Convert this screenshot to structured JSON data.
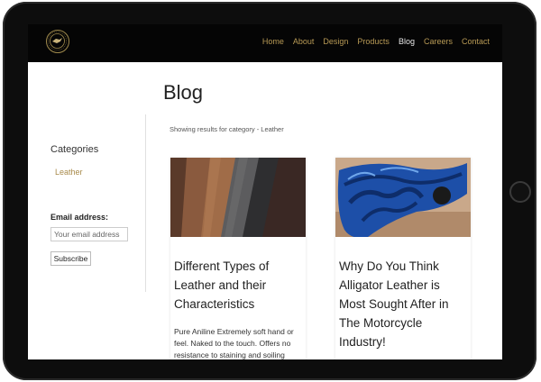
{
  "nav": {
    "items": [
      {
        "label": "Home"
      },
      {
        "label": "About"
      },
      {
        "label": "Design"
      },
      {
        "label": "Products"
      },
      {
        "label": "Blog",
        "active": true
      },
      {
        "label": "Careers"
      },
      {
        "label": "Contact"
      }
    ]
  },
  "page": {
    "title": "Blog",
    "results_text": "Showing results for category - Leather"
  },
  "sidebar": {
    "categories_heading": "Categories",
    "categories": [
      {
        "label": "Leather"
      }
    ],
    "email_label": "Email address:",
    "email_placeholder": "Your email address",
    "subscribe_label": "Subscribe"
  },
  "posts": [
    {
      "title": "Different Types of Leather and their Characteristics",
      "excerpt": "Pure Aniline Extremely soft hand or feel. Naked to the touch. Offers no resistance to staining and soiling from"
    },
    {
      "title": "Why Do You Think Alligator Leather is Most Sought After in The Motorcycle Industry!",
      "excerpt": ""
    }
  ],
  "colors": {
    "nav_bg": "#050505",
    "nav_link": "#b89a55",
    "nav_active": "#e8e8e8",
    "accent": "#a88a4a"
  }
}
